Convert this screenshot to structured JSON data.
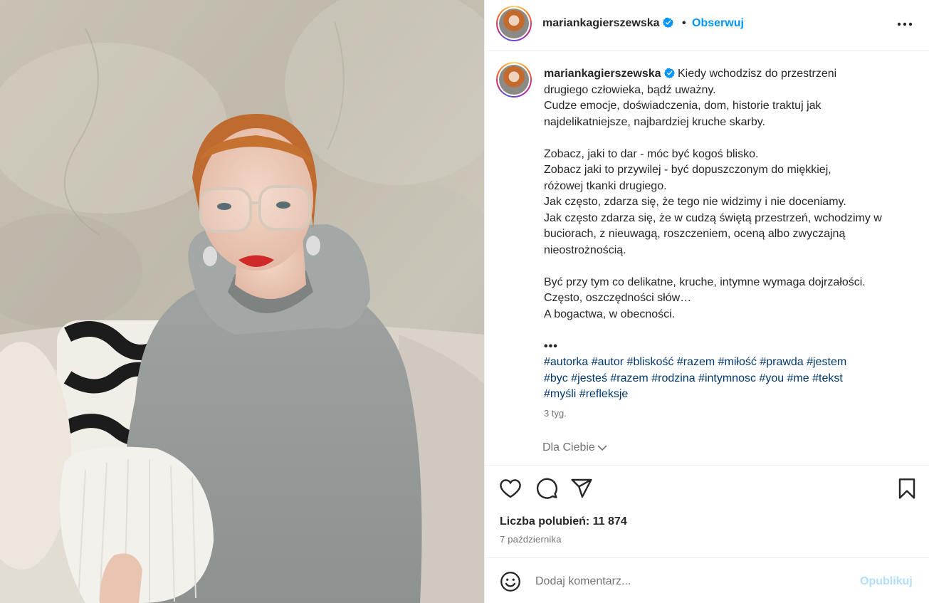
{
  "post": {
    "username": "mariankagierszewska",
    "verified": true,
    "separator": "•",
    "follow_label": "Obserwuj",
    "more_icon": "more-horizontal-icon"
  },
  "caption": {
    "username": "mariankagierszewska",
    "lines": [
      "Kiedy wchodzisz do przestrzeni",
      "drugiego człowieka, bądź uważny.",
      "Cudze emocje, doświadczenia, dom, historie traktuj jak",
      "najdelikatniejsze, najbardziej kruche skarby.",
      "",
      "Zobacz, jaki to dar - móc być kogoś blisko.",
      "Zobacz jaki to przywilej - być dopuszczonym do miękkiej,",
      "różowej tkanki drugiego.",
      "Jak często, zdarza się, że tego nie widzimy i nie doceniamy.",
      "Jak często zdarza się, że w cudzą świętą przestrzeń, wchodzimy w",
      "buciorach, z nieuwagą, roszczeniem, oceną albo zwyczajną",
      "nieostrożnością.",
      "",
      "Być przy tym co delikatne, kruche, intymne wymaga dojrzałości.",
      "Często, oszczędności słów…",
      "A bogactwa, w obecności.",
      "",
      "•••"
    ],
    "hashtags": [
      [
        "#autorka",
        "#autor",
        "#bliskość",
        "#razem",
        "#miłość",
        "#prawda",
        "#jestem"
      ],
      [
        "#byc",
        "#jesteś",
        "#razem",
        "#rodzina",
        "#intymnosc",
        "#you",
        "#me",
        "#tekst"
      ],
      [
        "#myśli",
        "#refleksje"
      ]
    ],
    "time_ago": "3 tyg.",
    "for_you_label": "Dla Ciebie"
  },
  "actions": {
    "like_icon": "heart-icon",
    "comment_icon": "comment-icon",
    "share_icon": "send-icon",
    "save_icon": "bookmark-icon"
  },
  "likes": {
    "text": "Liczba polubień: 11 874"
  },
  "date": "7 października",
  "comment": {
    "emoji_icon": "emoji-icon",
    "placeholder": "Dodaj komentarz...",
    "publish_label": "Opublikuj"
  },
  "colors": {
    "accent": "#0095f6",
    "hashtag": "#00376b",
    "muted": "#737373",
    "publish_disabled": "#b2dffc",
    "border": "#efefef"
  }
}
